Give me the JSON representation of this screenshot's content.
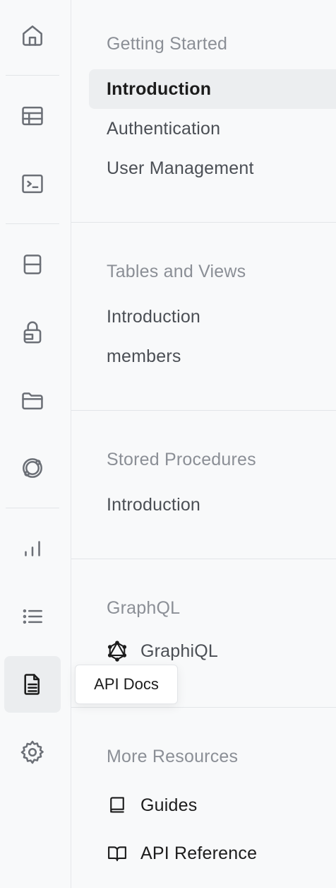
{
  "rail": {
    "icons": [
      "home-icon",
      "table-editor-icon",
      "sql-editor-icon",
      "database-icon",
      "auth-icon",
      "storage-icon",
      "realtime-icon",
      "reports-icon",
      "logs-icon",
      "api-docs-icon",
      "settings-icon"
    ],
    "active": "api-docs-icon"
  },
  "tooltip": {
    "label": "API Docs"
  },
  "menu": {
    "getting_started": {
      "title": "Getting Started",
      "items": [
        "Introduction",
        "Authentication",
        "User Management"
      ],
      "active_item": "Introduction"
    },
    "tables_views": {
      "title": "Tables and Views",
      "items": [
        "Introduction",
        "members"
      ]
    },
    "stored_procedures": {
      "title": "Stored Procedures",
      "items": [
        "Introduction"
      ]
    },
    "graphql": {
      "title": "GraphQL",
      "items": [
        {
          "label": "GraphiQL",
          "icon": "graphql-icon"
        }
      ]
    },
    "more_resources": {
      "title": "More Resources",
      "items": [
        {
          "label": "Guides",
          "icon": "book-icon"
        },
        {
          "label": "API Reference",
          "icon": "book-open-icon"
        }
      ]
    }
  }
}
